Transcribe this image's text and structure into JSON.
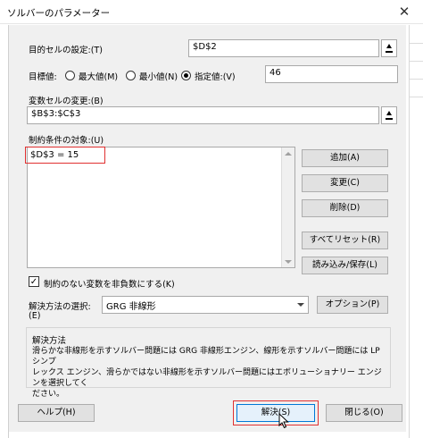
{
  "window": {
    "title": "ソルバーのパラメーター",
    "close_glyph": "✕"
  },
  "objective": {
    "label": "目的セルの設定:(T)",
    "value": "$D$2"
  },
  "target": {
    "label": "目標値:",
    "options": [
      "最大値(M)",
      "最小値(N)",
      "指定値:(V)"
    ],
    "selected_index": 2,
    "value": "46"
  },
  "variables": {
    "label": "変数セルの変更:(B)",
    "value": "$B$3:$C$3"
  },
  "constraints": {
    "label": "制約条件の対象:(U)",
    "items": [
      "$D$3 = 15"
    ],
    "buttons": {
      "add": "追加(A)",
      "change": "変更(C)",
      "delete": "削除(D)",
      "reset": "すべてリセット(R)",
      "load_save": "読み込み/保存(L)"
    }
  },
  "nonneg": {
    "label": "制約のない変数を非負数にする(K)",
    "checked": true
  },
  "method": {
    "label_line1": "解決方法の選択:",
    "label_line2": "(E)",
    "value": "GRG 非線形",
    "options_button": "オプション(P)"
  },
  "method_group": {
    "title": "解決方法",
    "text_lines": [
      "滑らかな非線形を示すソルバー問題には GRG 非線形エンジン、線形を示すソルバー問題には LP シンプ",
      "レックス エンジン、滑らかではない非線形を示すソルバー問題にはエボリューショナリー エンジンを選択してく",
      "ださい。"
    ]
  },
  "footer": {
    "help": "ヘルプ(H)",
    "solve": "解決(S)",
    "close": "閉じる(O)"
  },
  "colors": {
    "highlight": "#e03030",
    "dialog_bg": "#f0f0f0"
  }
}
